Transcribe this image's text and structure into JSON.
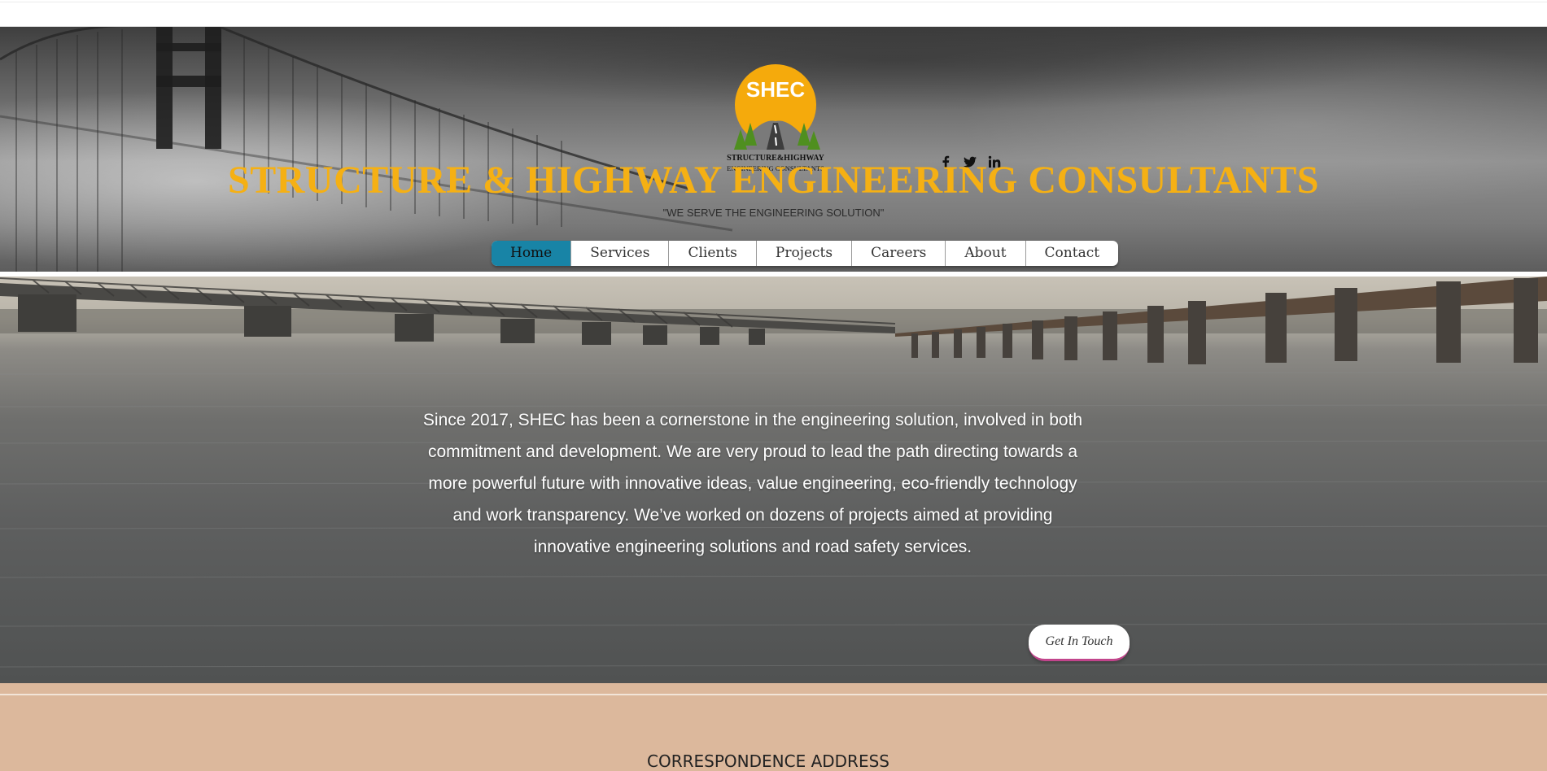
{
  "site": {
    "title": "STRUCTURE & HIGHWAY ENGINEERING CONSULTANTS",
    "tagline": "\"WE SERVE THE ENGINEERING SOLUTION\"",
    "brand_color": "#f5b014"
  },
  "logo": {
    "abbreviation": "SHEC",
    "line1": "STRUCTURE&HIGHWAY",
    "line2": "ENGINEERING CONSULTANTS"
  },
  "social": [
    {
      "icon": "facebook-icon"
    },
    {
      "icon": "twitter-icon"
    },
    {
      "icon": "linkedin-icon"
    }
  ],
  "nav": {
    "items": [
      {
        "label": "Home",
        "active": true
      },
      {
        "label": "Services"
      },
      {
        "label": "Clients"
      },
      {
        "label": "Projects"
      },
      {
        "label": "Careers"
      },
      {
        "label": "About"
      },
      {
        "label": "Contact"
      }
    ],
    "active_color": "#1884a6"
  },
  "hero": {
    "text": "Since 2017, SHEC has been a cornerstone in the engineering solution, involved in both commitment and development. We are very proud to lead the path directing towards a more powerful future with innovative ideas, value engineering, eco-friendly technology and work transparency. We’ve worked on dozens of projects aimed at providing innovative engineering solutions and road safety services.",
    "cta_label": "Get In Touch"
  },
  "footer": {
    "heading": "CORRESPONDENCE ADDRESS",
    "background": "#dcb89c"
  }
}
